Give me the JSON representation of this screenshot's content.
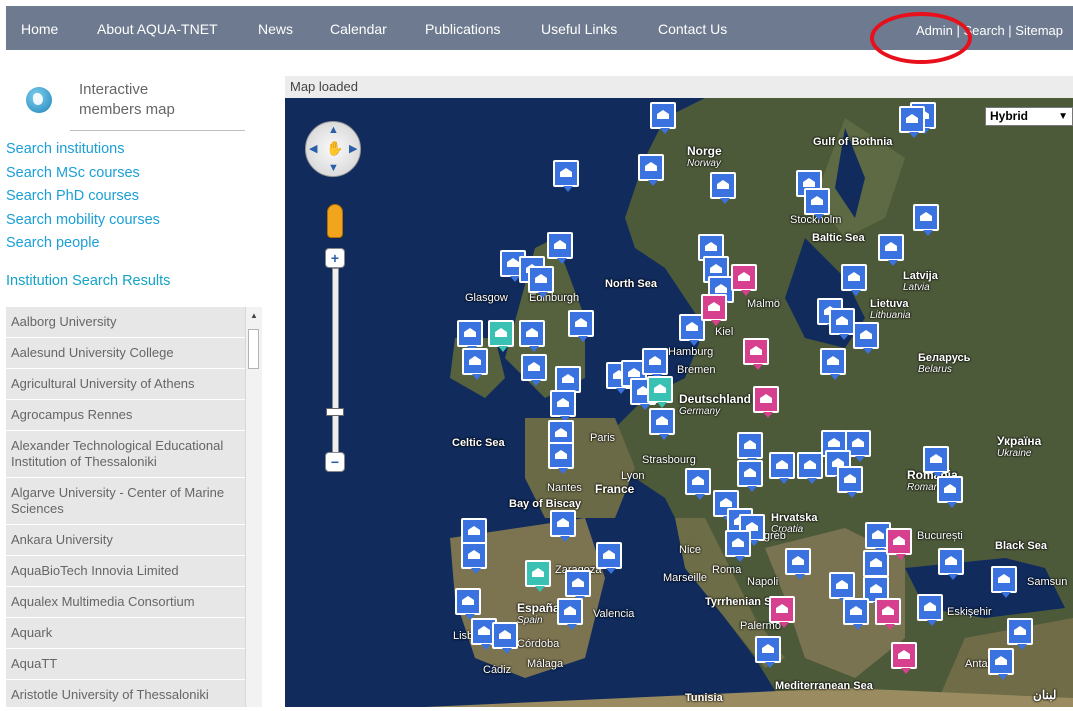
{
  "nav": {
    "items": [
      {
        "label": "Home"
      },
      {
        "label": "About AQUA-TNET"
      },
      {
        "label": "News"
      },
      {
        "label": "Calendar"
      },
      {
        "label": "Publications"
      },
      {
        "label": "Useful Links"
      },
      {
        "label": "Contact Us"
      }
    ],
    "right": {
      "admin": "Admin",
      "search": "Search",
      "sitemap": "Sitemap",
      "sep": " | "
    }
  },
  "sidebar": {
    "title_line1": "Interactive",
    "title_line2": "members map",
    "links": [
      {
        "label": "Search institutions"
      },
      {
        "label": "Search MSc courses"
      },
      {
        "label": "Search PhD courses"
      },
      {
        "label": "Search mobility courses"
      },
      {
        "label": "Search people"
      }
    ],
    "results_heading": "Institution Search Results",
    "results": [
      {
        "label": "Aalborg University"
      },
      {
        "label": "Aalesund University College"
      },
      {
        "label": "Agricultural University of Athens"
      },
      {
        "label": "Agrocampus Rennes"
      },
      {
        "label": "Alexander Technological Educational Institution of Thessaloniki"
      },
      {
        "label": "Algarve University - Center of Marine Sciences"
      },
      {
        "label": "Ankara University"
      },
      {
        "label": "AquaBioTech Innovia Limited"
      },
      {
        "label": "Aqualex Multimedia Consortium"
      },
      {
        "label": "Aquark"
      },
      {
        "label": "AquaTT"
      },
      {
        "label": "Aristotle University of Thessaloniki"
      }
    ]
  },
  "map": {
    "status": "Map loaded",
    "map_type": "Hybrid",
    "labels": {
      "norge": "Norge",
      "norway": "Norway",
      "bothnia": "Gulf of Bothnia",
      "north_sea": "North Sea",
      "baltic": "Baltic Sea",
      "latvija": "Latvija",
      "latvia": "Latvia",
      "lietuva": "Lietuva",
      "lithuania": "Lithuania",
      "belarus_local": "Беларусь",
      "belarus": "Belarus",
      "ukraine_local": "Україна",
      "ukraine": "Ukraine",
      "deutschland": "Deutschland",
      "germany": "Germany",
      "france": "France",
      "celtic": "Celtic Sea",
      "biscay": "Bay of Biscay",
      "espana": "España",
      "spain": "Spain",
      "romania_local": "România",
      "romania": "Romania",
      "black_sea": "Black Sea",
      "tyrrhenian": "Tyrrhenian Sea",
      "mediterranean": "Mediterranean Sea",
      "tunisia": "Tunisia",
      "hrvatska": "Hrvatska",
      "croatia": "Croatia",
      "stockholm": "Stockholm",
      "edinburgh": "Edinburgh",
      "glasgow": "Glasgow",
      "marseille": "Marseille",
      "nice": "Nice",
      "roma": "Roma",
      "napoli": "Napoli",
      "palermo": "Palermo",
      "bucuresti": "București",
      "zagreb": "Zagreb",
      "malaga": "Málaga",
      "cordoba": "Córdoba",
      "valencia": "Valencia",
      "zaragoza": "Zaragoza",
      "nantes": "Nantes",
      "paris": "Paris",
      "lyon": "Lyon",
      "strasbourg": "Strasbourg",
      "bremen": "Bremen",
      "hamburg": "Hamburg",
      "malmo": "Malmö",
      "kiel": "Kiel",
      "cadiz": "Cádiz",
      "lisboa": "Lisb",
      "samsun": "Samsun",
      "antalya": "Antalya",
      "eskisehir": "Eskişehir",
      "lebanon": "لبنان"
    },
    "colors": {
      "institution": "#3a73e0",
      "museum": "#d6408f",
      "people": "#39c2b4"
    }
  }
}
